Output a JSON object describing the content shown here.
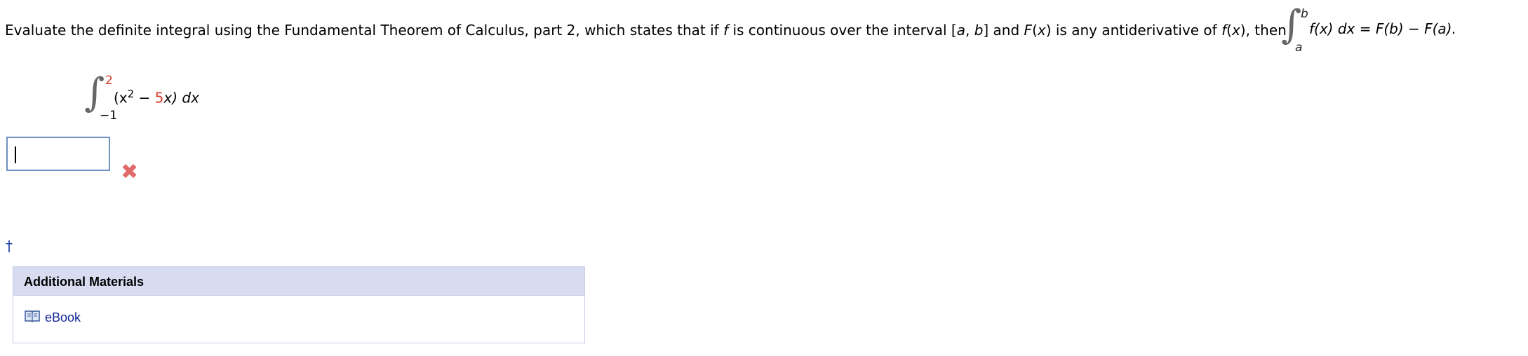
{
  "question": {
    "prompt_part1": "Evaluate the definite integral using the Fundamental Theorem of Calculus, part 2, which states that if ",
    "var_f": "f",
    "prompt_part2": " is continuous over the interval [",
    "var_a": "a",
    "comma": ", ",
    "var_b": "b",
    "prompt_part3": "] and ",
    "F_of_x": "F",
    "prompt_part4": "(",
    "x1": "x",
    "prompt_part5": ") is any antiderivative of ",
    "f_of_x": "f",
    "prompt_part6": "(",
    "x2": "x",
    "prompt_part7": "), then",
    "theorem_upper": "b",
    "theorem_lower": "a",
    "theorem_body": "f(x) dx = F(b) − F(a)."
  },
  "integral": {
    "upper_limit": "2",
    "lower_limit": "−1",
    "integrand_prefix": "(x",
    "exponent": "2",
    "minus": " − ",
    "coefficient": "5",
    "integrand_suffix": "x) dx"
  },
  "answer": {
    "value": "",
    "status_icon": "incorrect-x-icon"
  },
  "footnote_symbol": "†",
  "additional_materials": {
    "title": "Additional Materials",
    "items": [
      {
        "label": "eBook",
        "icon": "book-icon"
      }
    ]
  },
  "colors": {
    "accent_red": "#d93a2b",
    "link_blue": "#15289a",
    "panel_header": "#d8dcf1",
    "input_border": "#6f8fbf",
    "error_mark": "#e16a6a"
  }
}
